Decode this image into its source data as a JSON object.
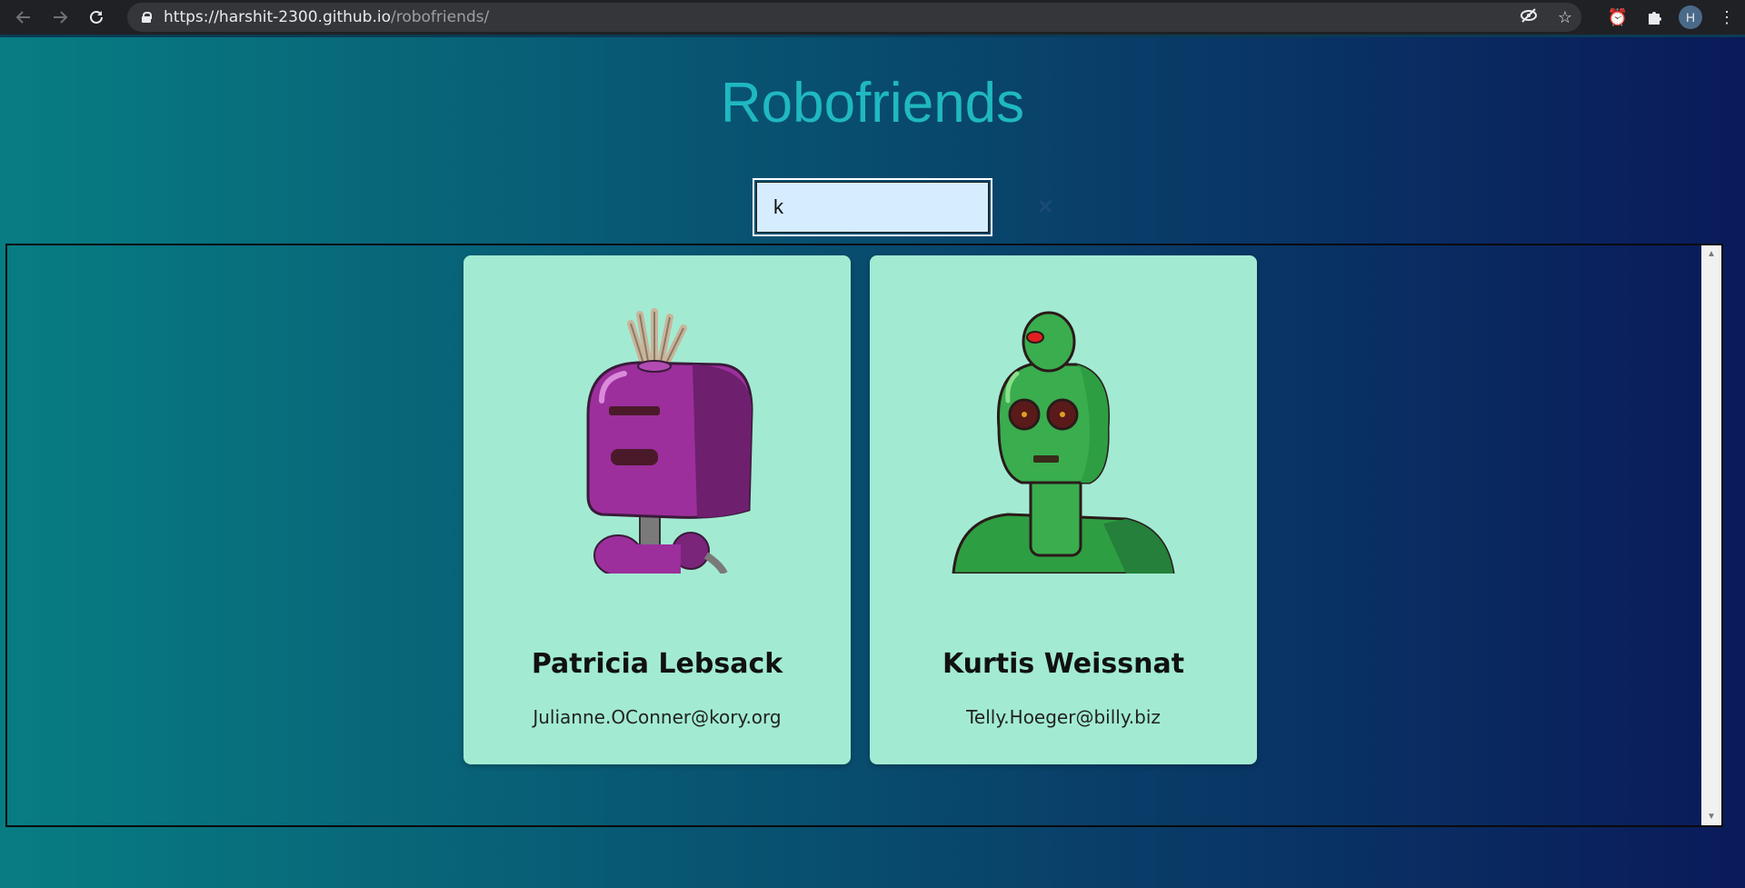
{
  "browser": {
    "url_host": "https://harshit-2300.github.io",
    "url_path": "/robofriends/",
    "avatar_letter": "H"
  },
  "page": {
    "title": "Robofriends"
  },
  "search": {
    "value": "k",
    "clear_glyph": "✕"
  },
  "robots": [
    {
      "name": "Patricia Lebsack",
      "email": "Julianne.OConner@kory.org",
      "avatar_icon": "purple-robot-icon"
    },
    {
      "name": "Kurtis Weissnat",
      "email": "Telly.Hoeger@billy.biz",
      "avatar_icon": "green-robot-icon"
    }
  ],
  "colors": {
    "title": "#1fb8c1",
    "card": "#a2ebd2",
    "gradient_start": "#077d82",
    "gradient_end": "#0a1a5a"
  }
}
